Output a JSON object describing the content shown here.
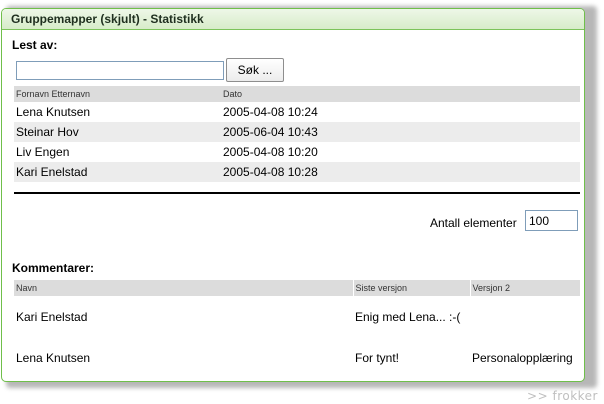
{
  "panel": {
    "title": "Gruppemapper (skjult) - Statistikk"
  },
  "readers": {
    "label": "Lest av:",
    "search": {
      "value": "",
      "button_label": "Søk ..."
    },
    "columns": [
      "Fornavn Etternavn",
      "Dato"
    ],
    "rows": [
      {
        "name": "Lena Knutsen",
        "date": "2005-04-08 10:24"
      },
      {
        "name": "Steinar Hov",
        "date": "2005-06-04 10:43"
      },
      {
        "name": "Liv Engen",
        "date": "2005-04-08 10:20"
      },
      {
        "name": "Kari Enelstad",
        "date": "2005-04-08 10:28"
      }
    ]
  },
  "count": {
    "label": "Antall elementer",
    "value": "100"
  },
  "comments": {
    "label": "Kommentarer:",
    "columns": [
      "Navn",
      "Siste versjon",
      "Versjon 2"
    ],
    "rows": [
      {
        "name": "Kari Enelstad",
        "latest": "Enig med Lena... :-(",
        "v2": ""
      },
      {
        "name": "Lena Knutsen",
        "latest": "For tynt!",
        "v2": "Personalopplæring"
      }
    ]
  },
  "watermark": ">> frokker"
}
